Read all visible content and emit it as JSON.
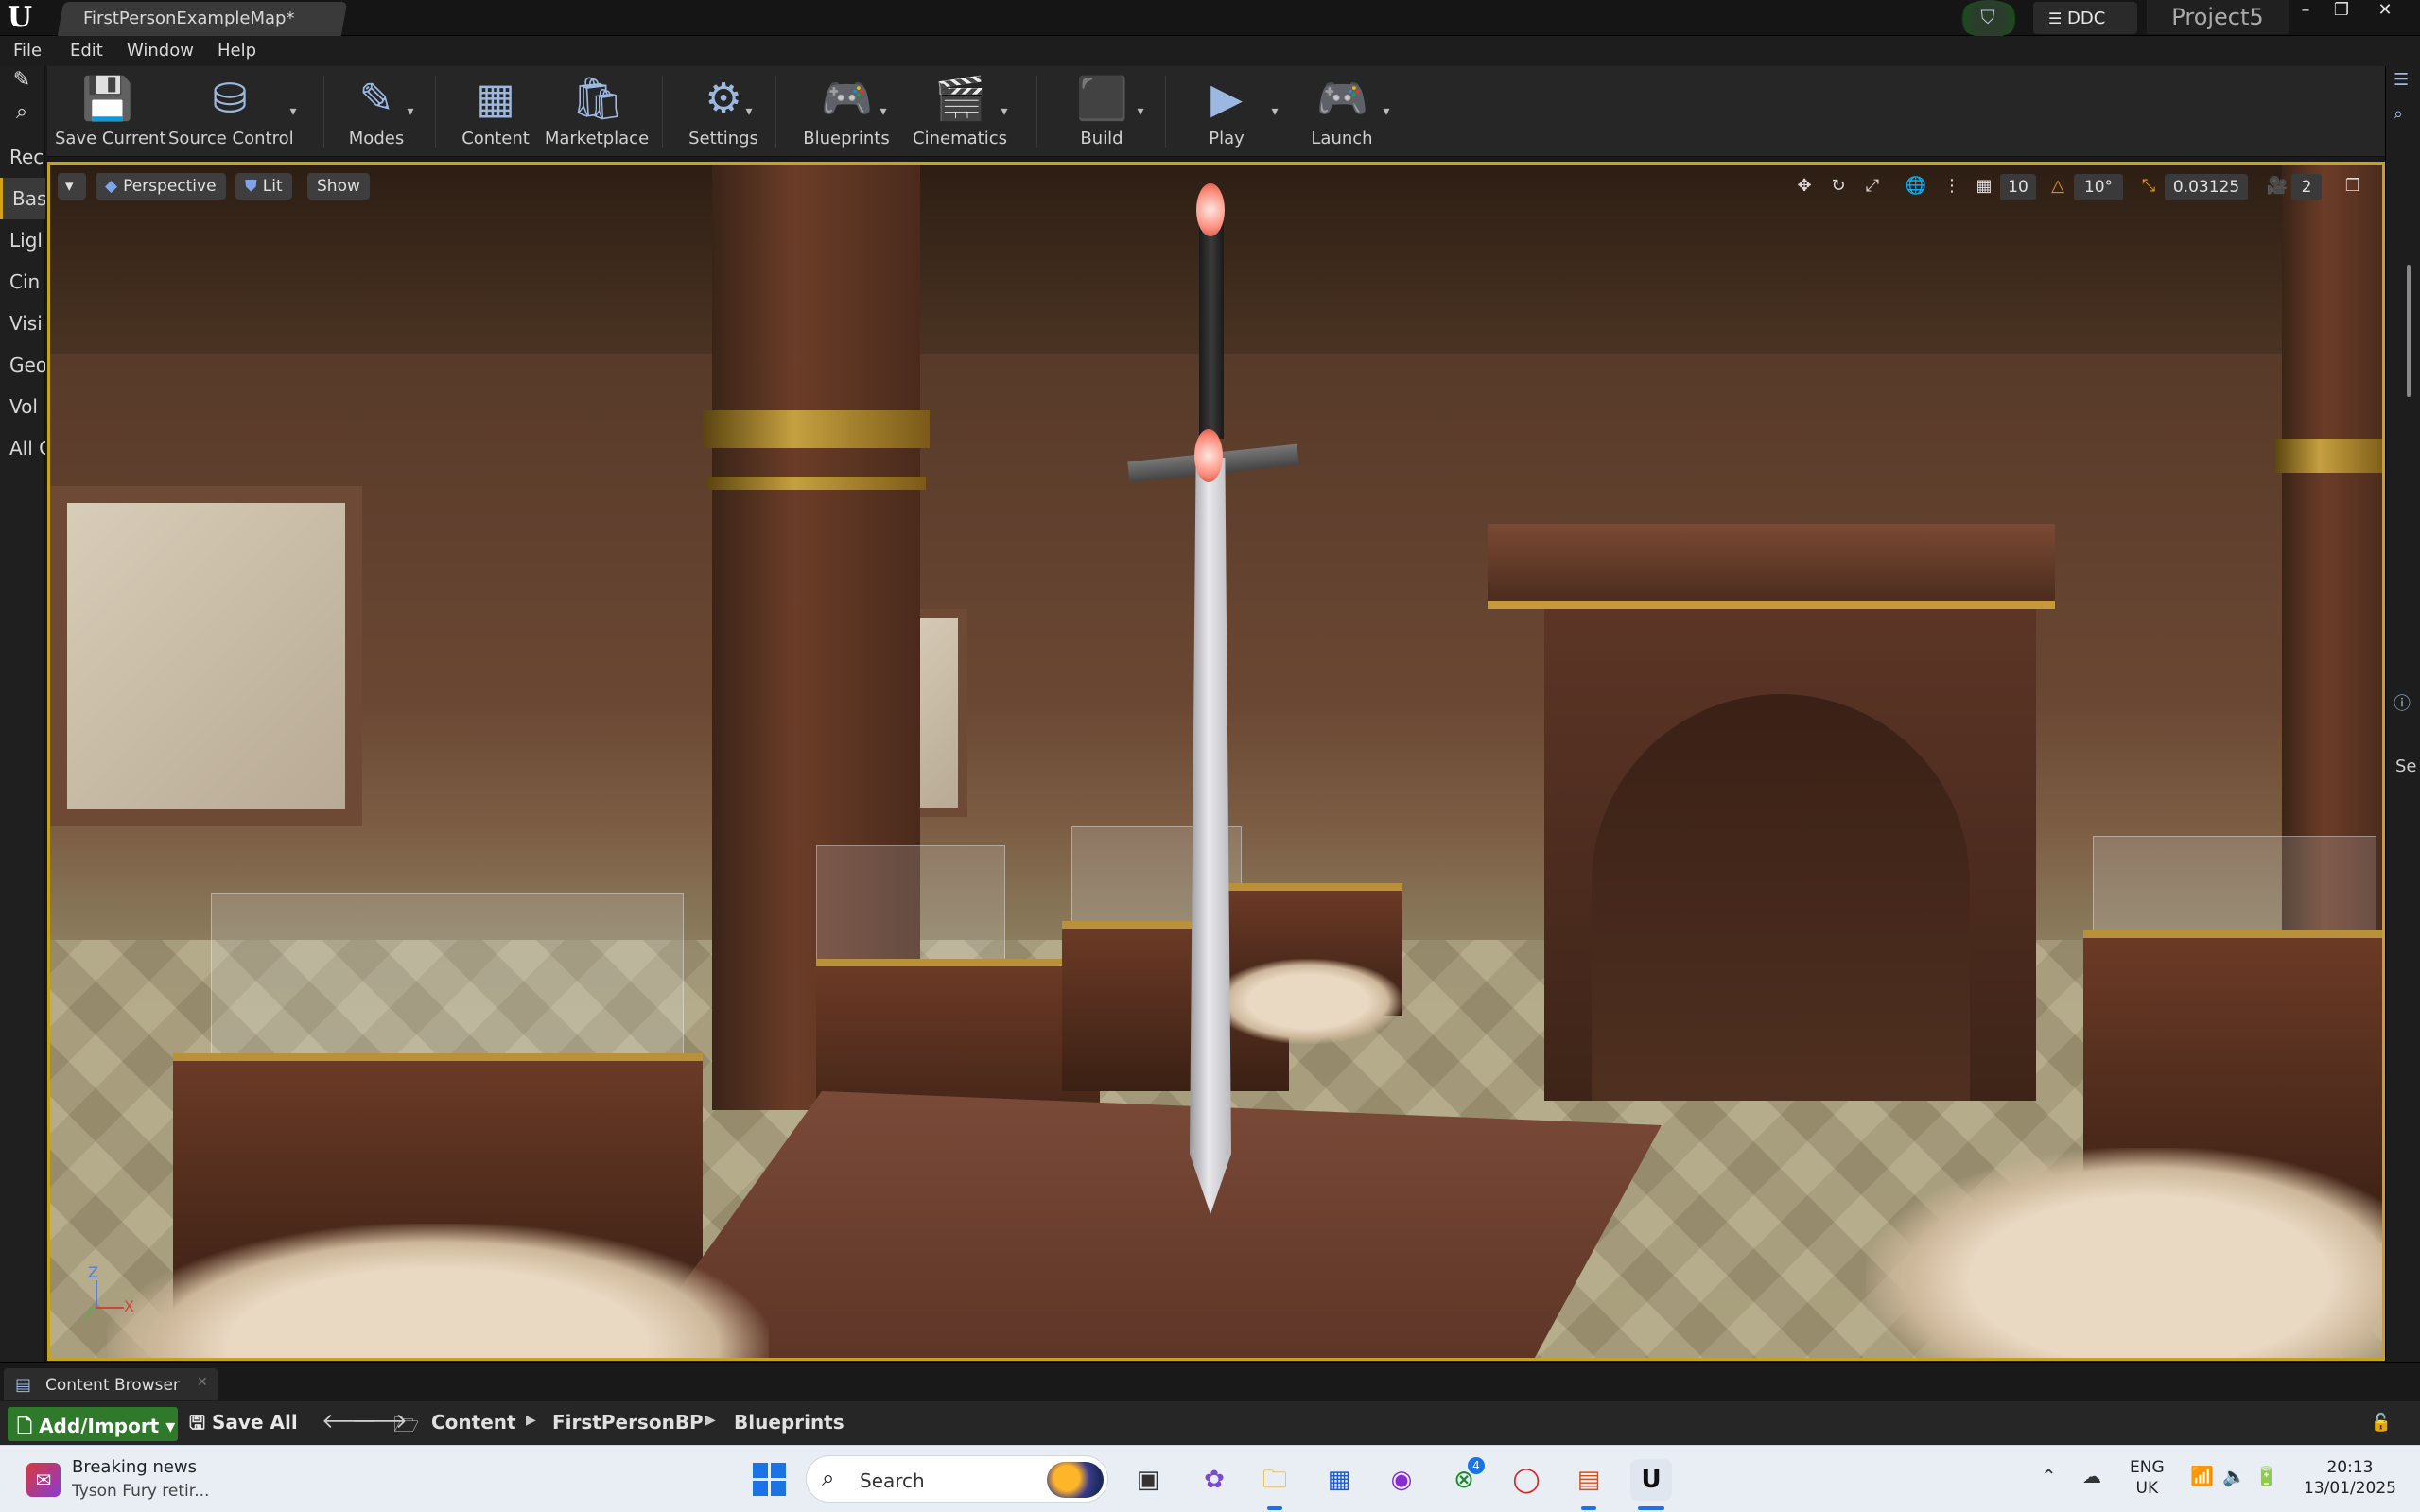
{
  "window": {
    "logo_text": "U",
    "doc_tab": "FirstPersonExampleMap*",
    "ddc_label": "DDC",
    "project": "Project5",
    "controls": {
      "minimize": "–",
      "maximize": "❐",
      "close": "✕"
    }
  },
  "menu": [
    "File",
    "Edit",
    "Window",
    "Help"
  ],
  "sidebar": {
    "categories": [
      "Rec",
      "Bas",
      "Ligl",
      "Cin",
      "Visi",
      "Geo",
      "Vol",
      "All C"
    ],
    "active_index": 1
  },
  "toolbar": {
    "items": [
      {
        "label": "Save Current",
        "icon": "save-icon",
        "glyph": "💾"
      },
      {
        "label": "Source Control",
        "icon": "source-control-icon",
        "glyph": "⛁"
      },
      {
        "label": "Modes",
        "icon": "modes-icon",
        "glyph": "✎"
      },
      {
        "label": "Content",
        "icon": "content-icon",
        "glyph": "▦"
      },
      {
        "label": "Marketplace",
        "icon": "marketplace-icon",
        "glyph": "🛍"
      },
      {
        "label": "Settings",
        "icon": "settings-icon",
        "glyph": "⚙"
      },
      {
        "label": "Blueprints",
        "icon": "blueprints-icon",
        "glyph": "🎮"
      },
      {
        "label": "Cinematics",
        "icon": "cinematics-icon",
        "glyph": "🎬"
      },
      {
        "label": "Build",
        "icon": "build-icon",
        "glyph": "⬛"
      },
      {
        "label": "Play",
        "icon": "play-icon",
        "glyph": "▶"
      },
      {
        "label": "Launch",
        "icon": "launch-icon",
        "glyph": "🎮"
      }
    ]
  },
  "viewport": {
    "view_mode": "Perspective",
    "lighting": "Lit",
    "show": "Show",
    "grid_snap": "10",
    "rotation_snap": "10°",
    "scale_snap": "0.03125",
    "camera_speed": "2",
    "axis": {
      "z": "Z",
      "x": "X"
    }
  },
  "content_browser": {
    "tab": "Content Browser",
    "add_import": "Add/Import",
    "save_all": "Save All",
    "breadcrumbs": [
      "Content",
      "FirstPersonBP",
      "Blueprints"
    ]
  },
  "right_panel": {
    "text": "Se"
  },
  "taskbar": {
    "news_title": "Breaking news",
    "news_sub": "Tyson Fury retir...",
    "search_label": "Search",
    "badge": "4",
    "lang_top": "ENG",
    "lang_bottom": "UK",
    "time": "20:13",
    "date": "13/01/2025"
  },
  "colors": {
    "accent": "#c7a318",
    "add_import": "#2f7a2a",
    "windows_blue": "#1a73e8"
  }
}
